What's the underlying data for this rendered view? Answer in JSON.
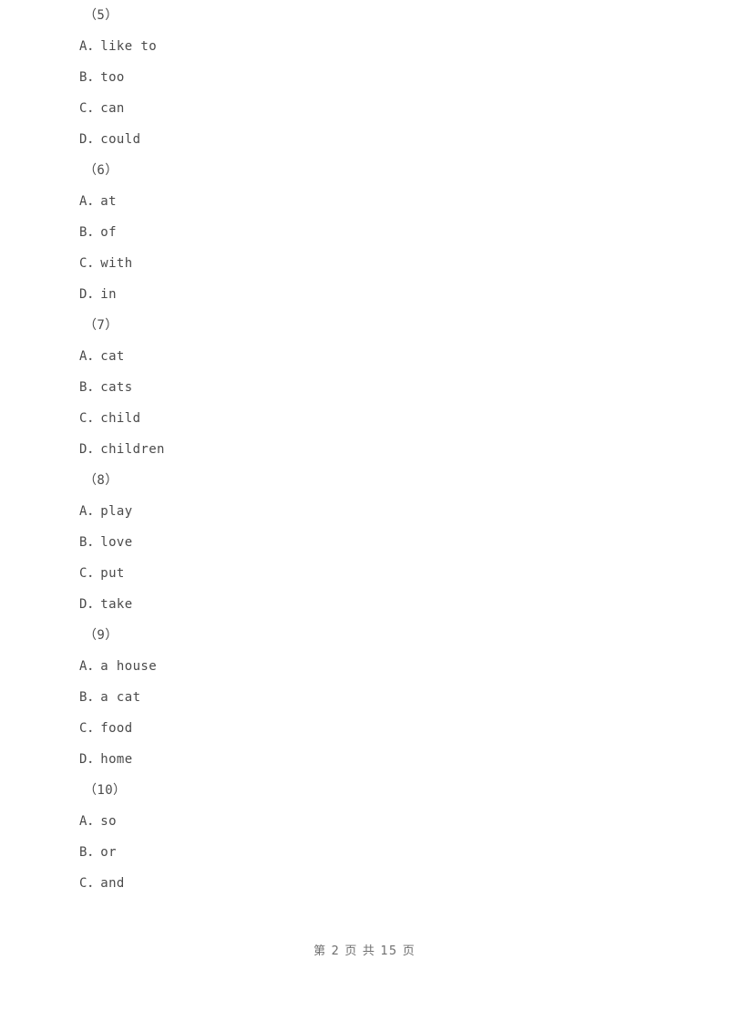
{
  "document": {
    "page_background": "#ffffff",
    "text_color": "#4a4a4a",
    "footer_color": "#6f6f6f"
  },
  "questions": [
    {
      "number": "（5）",
      "options": [
        {
          "letter": "A",
          "separator": "．",
          "text": "like to"
        },
        {
          "letter": "B",
          "separator": "．",
          "text": "too"
        },
        {
          "letter": "C",
          "separator": "．",
          "text": "can"
        },
        {
          "letter": "D",
          "separator": "．",
          "text": "could"
        }
      ]
    },
    {
      "number": "（6）",
      "options": [
        {
          "letter": "A",
          "separator": "．",
          "text": "at"
        },
        {
          "letter": "B",
          "separator": "．",
          "text": "of"
        },
        {
          "letter": "C",
          "separator": "．",
          "text": "with"
        },
        {
          "letter": "D",
          "separator": "．",
          "text": "in"
        }
      ]
    },
    {
      "number": "（7）",
      "options": [
        {
          "letter": "A",
          "separator": "．",
          "text": "cat"
        },
        {
          "letter": "B",
          "separator": "．",
          "text": "cats"
        },
        {
          "letter": "C",
          "separator": "．",
          "text": "child"
        },
        {
          "letter": "D",
          "separator": "．",
          "text": "children"
        }
      ]
    },
    {
      "number": "（8）",
      "options": [
        {
          "letter": "A",
          "separator": "．",
          "text": "play"
        },
        {
          "letter": "B",
          "separator": "．",
          "text": "love"
        },
        {
          "letter": "C",
          "separator": "．",
          "text": "put"
        },
        {
          "letter": "D",
          "separator": "．",
          "text": "take"
        }
      ]
    },
    {
      "number": "（9）",
      "options": [
        {
          "letter": "A",
          "separator": "．",
          "text": "a house"
        },
        {
          "letter": "B",
          "separator": "．",
          "text": "a cat"
        },
        {
          "letter": "C",
          "separator": "．",
          "text": "food"
        },
        {
          "letter": "D",
          "separator": "．",
          "text": "home"
        }
      ]
    },
    {
      "number": "（10）",
      "options": [
        {
          "letter": "A",
          "separator": "．",
          "text": "so"
        },
        {
          "letter": "B",
          "separator": "．",
          "text": "or"
        },
        {
          "letter": "C",
          "separator": "．",
          "text": "and"
        }
      ]
    }
  ],
  "footer": {
    "text": "第 2 页 共 15 页",
    "current_page": "2",
    "total_pages": "15"
  }
}
